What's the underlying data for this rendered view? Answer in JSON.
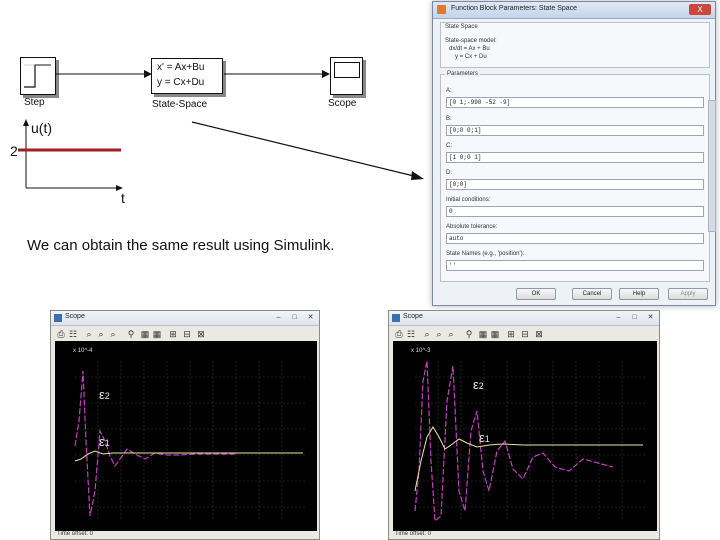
{
  "diagram": {
    "step_label": "Step",
    "statespace_line1": "x' = Ax+Bu",
    "statespace_line2": "y = Cx+Du",
    "statespace_label": "State-Space",
    "scope_label": "Scope"
  },
  "input_plot": {
    "ylabel": "u(t)",
    "xlabel": "t",
    "level": "2",
    "line_color": "#a31f24"
  },
  "caption": "We can obtain the same result using Simulink.",
  "dialog": {
    "title": "Function Block Parameters: State Space",
    "close_label": "X",
    "section_title": "State Space",
    "description_line1": "State-space model:",
    "description_line2": "dx/dt = Ax + Bu",
    "description_line3": "y = Cx + Du",
    "parameters_title": "Parameters",
    "fields": [
      {
        "label": "A:",
        "value": "[0 1;-990 -52 -9]"
      },
      {
        "label": "B:",
        "value": "[0;0 0;1]"
      },
      {
        "label": "C:",
        "value": "[1 0;0 1]"
      },
      {
        "label": "D:",
        "value": "[0;0]"
      },
      {
        "label": "Initial conditions:",
        "value": "0"
      },
      {
        "label": "Absolute tolerance:",
        "value": "auto"
      },
      {
        "label": "State Names (e.g., 'position'):",
        "value": "''"
      }
    ],
    "buttons": {
      "ok": "OK",
      "cancel": "Cancel",
      "help": "Help",
      "apply": "Apply"
    }
  },
  "scope_left": {
    "title": "Scope",
    "exponent": "x 10^-4",
    "eps2_label": "ε",
    "eps2_sub": "2",
    "eps1_label": "ε",
    "eps1_sub": "1",
    "time_offset": "Time offset: 0"
  },
  "scope_right": {
    "title": "Scope",
    "exponent": "x 10^-3",
    "eps2_label": "ε",
    "eps2_sub": "2",
    "eps1_label": "ε",
    "eps1_sub": "1",
    "time_offset": "Time offset: 0"
  },
  "colors": {
    "signal_line": "#a31f24",
    "trace_magenta": "#c040c0",
    "trace_yellow": "#e8e8a0",
    "plot_background": "#000000"
  }
}
